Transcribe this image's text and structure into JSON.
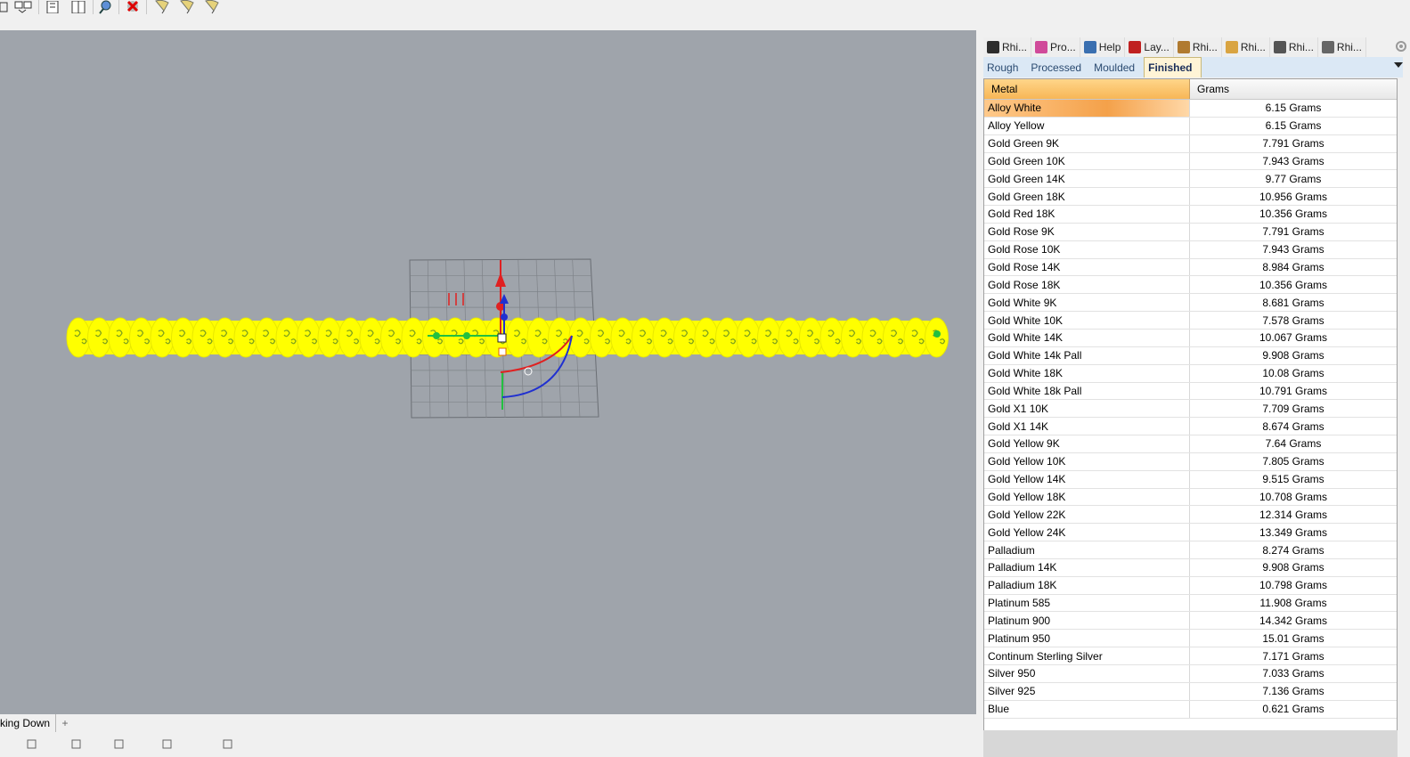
{
  "toolbar": {
    "icons": [
      "layout-icon",
      "view-icon",
      "layer-icon",
      "layer-icon-2",
      "zoom-icon",
      "delete-icon",
      "light-icon-1",
      "light-icon-2",
      "light-icon-3"
    ]
  },
  "viewport": {
    "tab_label": "king Down",
    "add_symbol": "+"
  },
  "panel": {
    "tabs": [
      {
        "label": "Rhi...",
        "icon": "rhino-gold-icon",
        "color": "#2d2d2d"
      },
      {
        "label": "Pro...",
        "icon": "color-wheel-icon",
        "color": "#d04a9a"
      },
      {
        "label": "Help",
        "icon": "help-icon",
        "color": "#3a6fb0"
      },
      {
        "label": "Lay...",
        "icon": "layer-icon",
        "color": "#c02020"
      },
      {
        "label": "Rhi...",
        "icon": "rhino-icon",
        "color": "#b07a30"
      },
      {
        "label": "Rhi...",
        "icon": "rhino-gem-icon",
        "color": "#d9a441"
      },
      {
        "label": "Rhi...",
        "icon": "clock-icon",
        "color": "#555555"
      },
      {
        "label": "Rhi...",
        "icon": "pot-icon",
        "color": "#666666"
      }
    ],
    "subtabs": [
      "Rough",
      "Processed",
      "Moulded",
      "Finished"
    ],
    "active_subtab": "Finished",
    "columns": {
      "metal": "Metal",
      "grams": "Grams"
    },
    "rows": [
      {
        "metal": "Alloy White",
        "grams": "6.15 Grams"
      },
      {
        "metal": "Alloy Yellow",
        "grams": "6.15 Grams"
      },
      {
        "metal": "Gold Green 9K",
        "grams": "7.791 Grams"
      },
      {
        "metal": "Gold Green 10K",
        "grams": "7.943 Grams"
      },
      {
        "metal": "Gold Green 14K",
        "grams": "9.77 Grams"
      },
      {
        "metal": "Gold Green 18K",
        "grams": "10.956 Grams"
      },
      {
        "metal": "Gold Red 18K",
        "grams": "10.356 Grams"
      },
      {
        "metal": "Gold Rose 9K",
        "grams": "7.791 Grams"
      },
      {
        "metal": "Gold Rose 10K",
        "grams": "7.943 Grams"
      },
      {
        "metal": "Gold Rose 14K",
        "grams": "8.984 Grams"
      },
      {
        "metal": "Gold Rose 18K",
        "grams": "10.356 Grams"
      },
      {
        "metal": "Gold White 9K",
        "grams": "8.681 Grams"
      },
      {
        "metal": "Gold White 10K",
        "grams": "7.578 Grams"
      },
      {
        "metal": "Gold White 14K",
        "grams": "10.067 Grams"
      },
      {
        "metal": "Gold White 14k Pall",
        "grams": "9.908 Grams"
      },
      {
        "metal": "Gold White 18K",
        "grams": "10.08 Grams"
      },
      {
        "metal": "Gold White 18k Pall",
        "grams": "10.791 Grams"
      },
      {
        "metal": "Gold X1 10K",
        "grams": "7.709 Grams"
      },
      {
        "metal": "Gold X1 14K",
        "grams": "8.674 Grams"
      },
      {
        "metal": "Gold Yellow 9K",
        "grams": "7.64 Grams"
      },
      {
        "metal": "Gold Yellow 10K",
        "grams": "7.805 Grams"
      },
      {
        "metal": "Gold Yellow 14K",
        "grams": "9.515 Grams"
      },
      {
        "metal": "Gold Yellow 18K",
        "grams": "10.708 Grams"
      },
      {
        "metal": "Gold Yellow 22K",
        "grams": "12.314 Grams"
      },
      {
        "metal": "Gold Yellow 24K",
        "grams": "13.349 Grams"
      },
      {
        "metal": "Palladium",
        "grams": "8.274 Grams"
      },
      {
        "metal": "Palladium 14K",
        "grams": "9.908 Grams"
      },
      {
        "metal": "Palladium 18K",
        "grams": "10.798 Grams"
      },
      {
        "metal": "Platinum 585",
        "grams": "11.908 Grams"
      },
      {
        "metal": "Platinum 900",
        "grams": "14.342 Grams"
      },
      {
        "metal": "Platinum 950",
        "grams": "15.01 Grams"
      },
      {
        "metal": "Continum Sterling Silver",
        "grams": "7.171 Grams"
      },
      {
        "metal": "Silver 950",
        "grams": "7.033 Grams"
      },
      {
        "metal": "Silver 925",
        "grams": "7.136 Grams"
      },
      {
        "metal": "Blue",
        "grams": "0.621 Grams"
      }
    ],
    "selected_row": 0
  },
  "colors": {
    "viewport_bg": "#9fa4ab",
    "chain": "#ffff00",
    "header_accent": "#f7b656"
  }
}
